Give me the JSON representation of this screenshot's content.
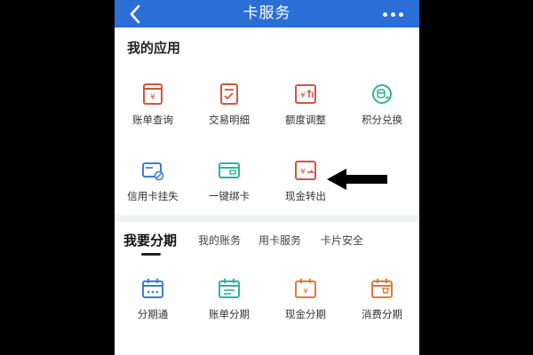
{
  "navbar": {
    "title": "卡服务",
    "back_icon": "back-chevron-icon",
    "more_icon": "more-dots-icon"
  },
  "my_apps": {
    "title": "我的应用",
    "items": [
      {
        "label": "账单查询",
        "icon": "bill-query-icon",
        "color": "#d9533f"
      },
      {
        "label": "交易明细",
        "icon": "transaction-detail-icon",
        "color": "#d9533f"
      },
      {
        "label": "额度调整",
        "icon": "limit-adjust-icon",
        "color": "#d9533f"
      },
      {
        "label": "积分兑换",
        "icon": "points-exchange-icon",
        "color": "#2fb39a"
      },
      {
        "label": "信用卡挂失",
        "icon": "card-loss-report-icon",
        "color": "#3a7fd5"
      },
      {
        "label": "一键绑卡",
        "icon": "bind-card-icon",
        "color": "#2fb39a"
      },
      {
        "label": "现金转出",
        "icon": "cash-transfer-out-icon",
        "color": "#d9533f"
      }
    ]
  },
  "installment": {
    "tabs": [
      {
        "label": "我要分期"
      },
      {
        "label": "我的账务"
      },
      {
        "label": "用卡服务"
      },
      {
        "label": "卡片安全"
      }
    ],
    "items": [
      {
        "label": "分期通",
        "icon": "installment-calendar-icon",
        "color": "#3a7fd5"
      },
      {
        "label": "账单分期",
        "icon": "bill-installment-icon",
        "color": "#2fb39a"
      },
      {
        "label": "现金分期",
        "icon": "cash-installment-icon",
        "color": "#e07b39"
      },
      {
        "label": "消费分期",
        "icon": "consumption-installment-icon",
        "color": "#e07b39"
      }
    ]
  },
  "annotation": {
    "icon": "pointer-arrow-icon",
    "color": "#000000"
  },
  "colors": {
    "nav_blue": "#2b6fd6",
    "red": "#d9533f",
    "teal": "#2fb39a",
    "blue": "#3a7fd5",
    "orange": "#e07b39"
  }
}
